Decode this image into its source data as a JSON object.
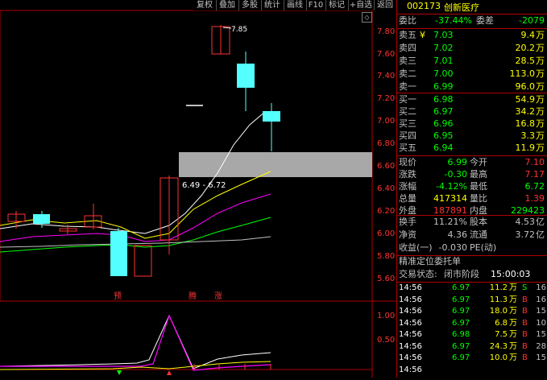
{
  "toolbar": {
    "buttons": [
      "复权",
      "叠加",
      "多股",
      "统计",
      "画线",
      "F10",
      "标记",
      "+自选",
      "返回"
    ]
  },
  "chart": {
    "axis_labels": [
      "7.80",
      "7.60",
      "7.40",
      "7.20",
      "7.00",
      "6.80",
      "6.60",
      "6.40",
      "6.20",
      "6.00",
      "5.80",
      "5.60"
    ],
    "high_label": "7.85",
    "range_label": "6.49 - 6.72",
    "markers": [
      "预",
      "腾",
      "涨"
    ],
    "indicator_labels": [
      "1.00",
      "0.50"
    ],
    "colors": {
      "up": "#ff3232",
      "down": "#54ffff",
      "ma1": "#ffffff",
      "ma2": "#ffff00",
      "ma3": "#ff00ff",
      "ma4": "#00ff00",
      "ma5": "#c0c0c0",
      "band": "#a8a8a8"
    }
  },
  "stock": {
    "code": "002173",
    "name": "创新医疗"
  },
  "order_book": {
    "weibi_label": "委比",
    "weibi_value": "-37.44%",
    "weicha_label": "委差",
    "weicha_value": "-2079",
    "sell": [
      {
        "label": "卖五",
        "price": "7.03",
        "volume": "9.4",
        "unit": "万",
        "extra": "¥"
      },
      {
        "label": "卖四",
        "price": "7.02",
        "volume": "20.2",
        "unit": "万",
        "extra": ""
      },
      {
        "label": "卖三",
        "price": "7.01",
        "volume": "28.5",
        "unit": "万",
        "extra": ""
      },
      {
        "label": "卖二",
        "price": "7.00",
        "volume": "113.0",
        "unit": "万",
        "extra": ""
      },
      {
        "label": "卖一",
        "price": "6.99",
        "volume": "96.0",
        "unit": "万",
        "extra": ""
      }
    ],
    "buy": [
      {
        "label": "买一",
        "price": "6.98",
        "volume": "54.9",
        "unit": "万"
      },
      {
        "label": "买二",
        "price": "6.97",
        "volume": "34.2",
        "unit": "万"
      },
      {
        "label": "买三",
        "price": "6.96",
        "volume": "16.8",
        "unit": "万"
      },
      {
        "label": "买四",
        "price": "6.95",
        "volume": "3.3",
        "unit": "万"
      },
      {
        "label": "买五",
        "price": "6.94",
        "volume": "11.9",
        "unit": "万"
      }
    ]
  },
  "stats": [
    {
      "l1": "现价",
      "v1": "6.99",
      "c1": "#00ff00",
      "l2": "今开",
      "v2": "7.10",
      "c2": "#ff3232"
    },
    {
      "l1": "涨跌",
      "v1": "-0.30",
      "c1": "#00ff00",
      "l2": "最高",
      "v2": "7.17",
      "c2": "#ff3232"
    },
    {
      "l1": "涨幅",
      "v1": "-4.12%",
      "c1": "#00ff00",
      "l2": "最低",
      "v2": "6.72",
      "c2": "#00ff00"
    },
    {
      "l1": "总量",
      "v1": "417314",
      "c1": "#ffff00",
      "l2": "量比",
      "v2": "1.39",
      "c2": "#ff3232"
    },
    {
      "l1": "外盘",
      "v1": "187891",
      "c1": "#ff3232",
      "l2": "内盘",
      "v2": "229423",
      "c2": "#00ff00"
    }
  ],
  "stats2": [
    {
      "l1": "换手",
      "v1": "11.21%",
      "l2": "股本",
      "v2": "4.53",
      "u2": "亿"
    },
    {
      "l1": "净资",
      "v1": "4.36",
      "l2": "流通",
      "v2": "3.72",
      "u2": "亿"
    },
    {
      "l1": "收益(一)",
      "v1": "-0.030",
      "l2": "PE(动)",
      "v2": "",
      "u2": ""
    }
  ],
  "order_section": {
    "title": "精准定位委托单",
    "status_label": "交易状态:",
    "status_value": "闭市阶段",
    "time": "15:00:03"
  },
  "ticks": [
    {
      "time": "14:56",
      "price": "6.97",
      "vol": "11.2",
      "unit": "万",
      "side": "S",
      "num": "16",
      "sc": "#00ff00"
    },
    {
      "time": "14:56",
      "price": "6.97",
      "vol": "11.3",
      "unit": "万",
      "side": "B",
      "num": "16",
      "sc": "#ff3232"
    },
    {
      "time": "14:56",
      "price": "6.97",
      "vol": "18.0",
      "unit": "万",
      "side": "B",
      "num": "15",
      "sc": "#ff3232"
    },
    {
      "time": "14:56",
      "price": "6.97",
      "vol": "6.8",
      "unit": "万",
      "side": "B",
      "num": "10",
      "sc": "#ff3232"
    },
    {
      "time": "14:56",
      "price": "6.98",
      "vol": "7.5",
      "unit": "万",
      "side": "B",
      "num": "15",
      "sc": "#ff3232"
    },
    {
      "time": "14:56",
      "price": "6.97",
      "vol": "24.3",
      "unit": "万",
      "side": "B",
      "num": "28",
      "sc": "#ff3232"
    },
    {
      "time": "14:56",
      "price": "6.97",
      "vol": "10.0",
      "unit": "万",
      "side": "B",
      "num": "15",
      "sc": "#ff3232"
    },
    {
      "time": "14:56",
      "price": "",
      "vol": "",
      "unit": "",
      "side": "",
      "num": "",
      "sc": "#ff3232"
    }
  ]
}
